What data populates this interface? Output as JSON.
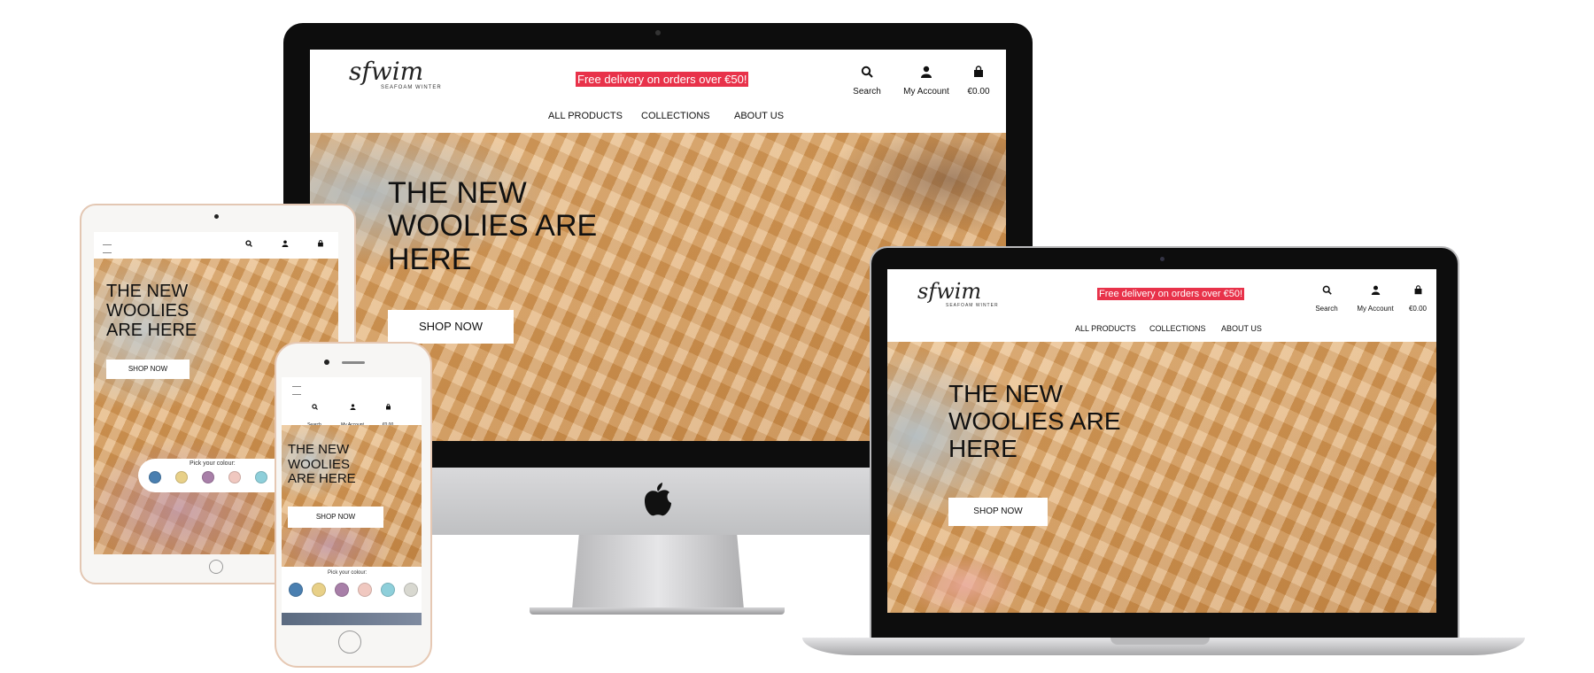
{
  "site": {
    "logo_script": "sfwim",
    "logo_sub": "SEAFOAM WINTER",
    "banner": "Free delivery on orders over €50!",
    "search_label": "Search",
    "account_label": "My Account",
    "cart_label": "€0.00",
    "nav": [
      "ALL PRODUCTS",
      "COLLECTIONS",
      "ABOUT US"
    ],
    "hero_title_lines": [
      "THE NEW",
      "WOOLIES ARE",
      "HERE"
    ],
    "hero_title_lines_small": [
      "THE NEW",
      "WOOLIES",
      "ARE HERE"
    ],
    "shop_now": "SHOP NOW",
    "pick_colour": "Pick your colour:"
  },
  "icons": {
    "search": "search-icon",
    "account": "user-icon",
    "cart": "shopping-bag-icon",
    "menu": "hamburger-menu-icon",
    "brand": "apple-logo-icon"
  },
  "colors": {
    "banner": "#e8324a",
    "swatches": [
      "#4a7fb0",
      "#e8d088",
      "#a87fa8",
      "#f0c8c0",
      "#8ecfda",
      "#d8d8d0"
    ]
  }
}
